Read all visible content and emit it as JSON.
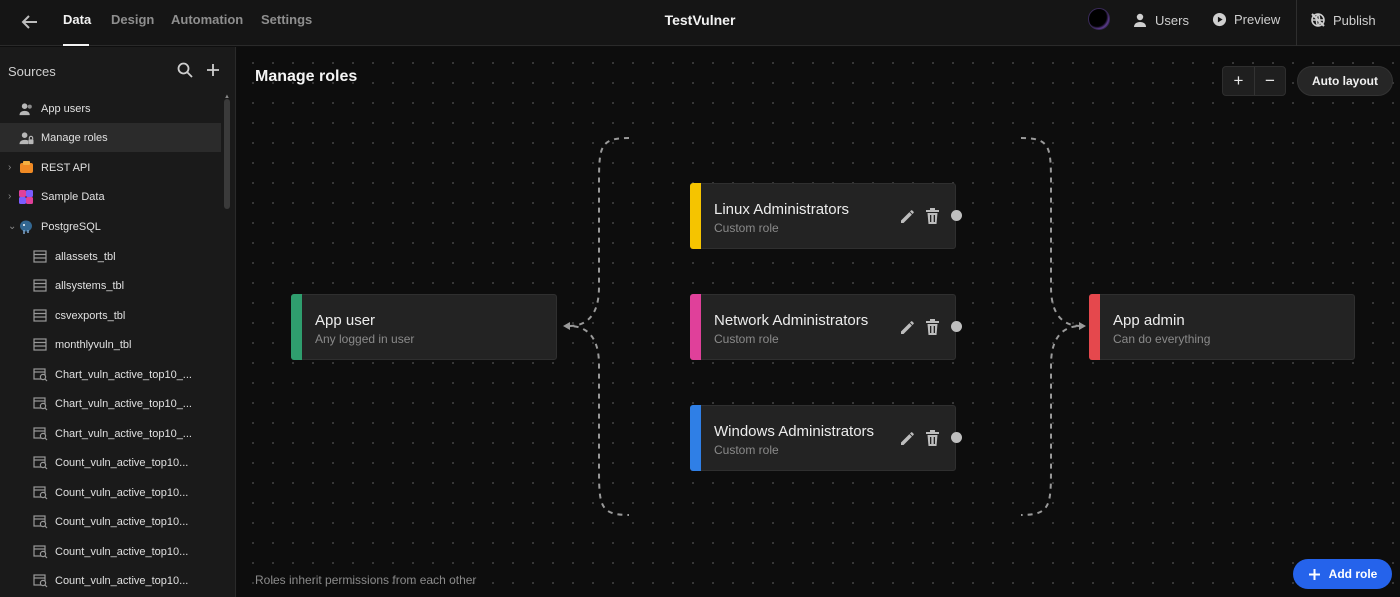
{
  "nav": {
    "tabs": [
      {
        "label": "Data",
        "active": true
      },
      {
        "label": "Design",
        "active": false
      },
      {
        "label": "Automation",
        "active": false
      },
      {
        "label": "Settings",
        "active": false
      }
    ],
    "app_title": "TestVulner",
    "actions": {
      "users": "Users",
      "preview": "Preview",
      "publish": "Publish"
    }
  },
  "sidebar": {
    "title": "Sources",
    "items": [
      {
        "label": "App users",
        "icon": "users-icon",
        "selected": false
      },
      {
        "label": "Manage roles",
        "icon": "user-lock-icon",
        "selected": true
      },
      {
        "label": "REST API",
        "icon": "rest-api-icon",
        "expandable": true
      },
      {
        "label": "Sample Data",
        "icon": "sample-data-icon",
        "expandable": true
      },
      {
        "label": "PostgreSQL",
        "icon": "postgresql-icon",
        "expanded": true
      },
      {
        "label": "allassets_tbl",
        "icon": "table-icon"
      },
      {
        "label": "allsystems_tbl",
        "icon": "table-icon"
      },
      {
        "label": "csvexports_tbl",
        "icon": "table-icon"
      },
      {
        "label": "monthlyvuln_tbl",
        "icon": "table-icon"
      },
      {
        "label": "Chart_vuln_active_top10_...",
        "icon": "query-icon"
      },
      {
        "label": "Chart_vuln_active_top10_...",
        "icon": "query-icon"
      },
      {
        "label": "Chart_vuln_active_top10_...",
        "icon": "query-icon"
      },
      {
        "label": "Count_vuln_active_top10...",
        "icon": "query-icon"
      },
      {
        "label": "Count_vuln_active_top10...",
        "icon": "query-icon"
      },
      {
        "label": "Count_vuln_active_top10...",
        "icon": "query-icon"
      },
      {
        "label": "Count_vuln_active_top10...",
        "icon": "query-icon"
      },
      {
        "label": "Count_vuln_active_top10...",
        "icon": "query-icon"
      }
    ]
  },
  "canvas": {
    "title": "Manage roles",
    "auto_layout": "Auto layout",
    "zoom_in": "+",
    "zoom_out": "−",
    "footer_hint": "Roles inherit permissions from each other",
    "add_role": "Add role"
  },
  "roles": {
    "app_user": {
      "name": "App user",
      "description": "Any logged in user",
      "color": "#2f9e6e"
    },
    "linux": {
      "name": "Linux Administrators",
      "description": "Custom role",
      "color": "#f5c400"
    },
    "network": {
      "name": "Network Administrators",
      "description": "Custom role",
      "color": "#e0409a"
    },
    "windows": {
      "name": "Windows Administrators",
      "description": "Custom role",
      "color": "#2f7fe6"
    },
    "app_admin": {
      "name": "App admin",
      "description": "Can do everything",
      "color": "#e5484d"
    }
  }
}
